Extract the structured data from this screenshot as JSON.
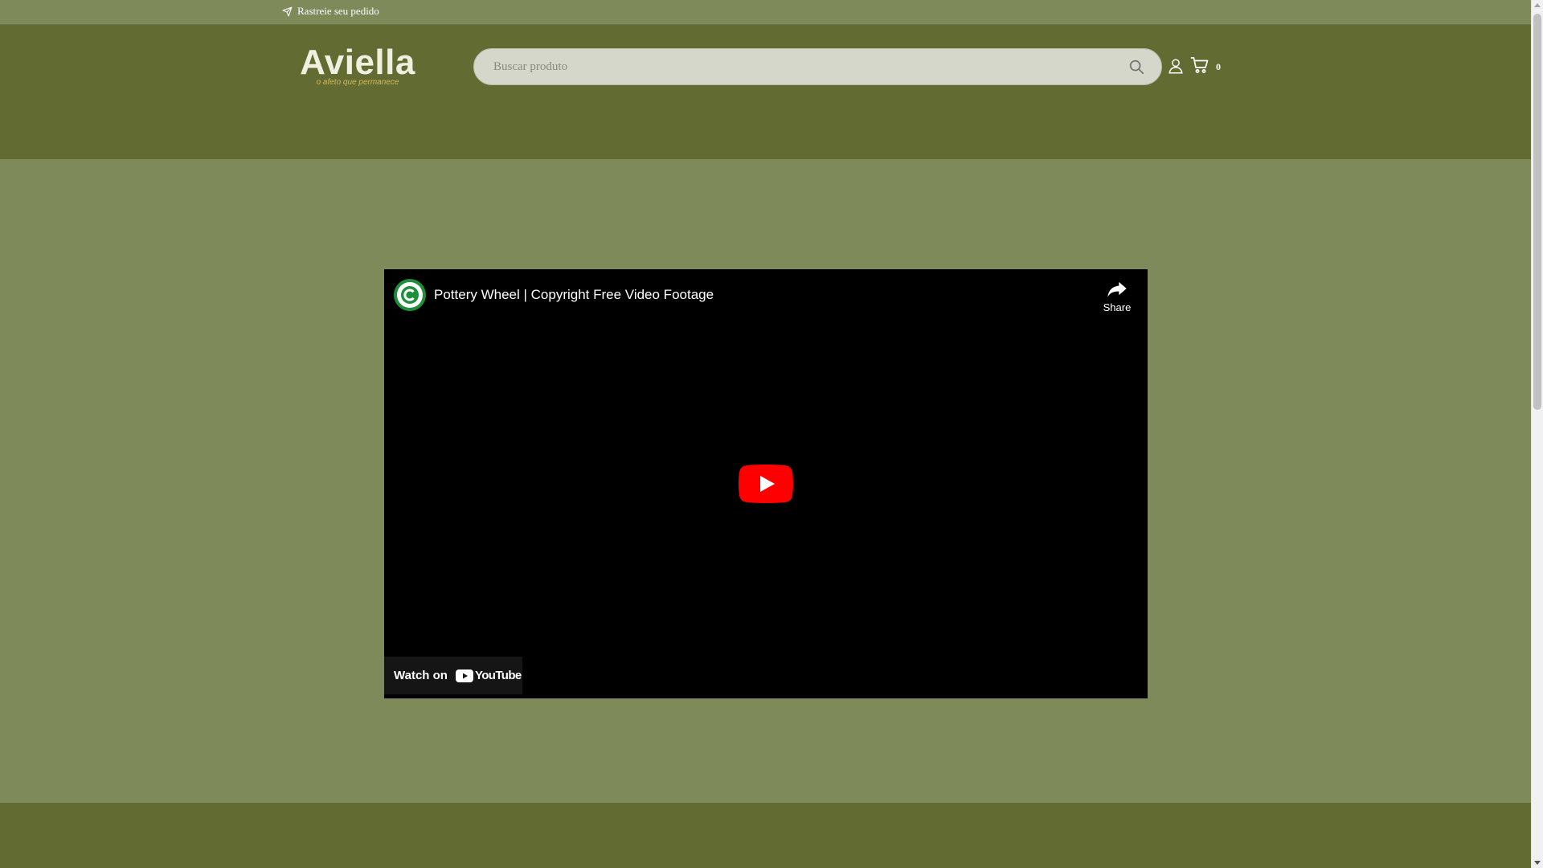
{
  "topbar": {
    "track_order_label": "Rastreie seu pedido"
  },
  "header": {
    "logo_text": "Aviella",
    "logo_tagline": "o afeto que permanece",
    "search": {
      "placeholder": "Buscar produto",
      "value": ""
    },
    "cart_count": "0"
  },
  "video": {
    "title": "Pottery Wheel | Copyright Free Video Footage",
    "share_label": "Share",
    "watch_on_label": "Watch on",
    "youtube_wordmark": "YouTube"
  },
  "colors": {
    "page_background": "#7f8a5b",
    "header_background": "#616b32",
    "logo_text": "#f1efe0",
    "logo_tagline": "#d4b95a",
    "search_background": "#d6d7cb",
    "youtube_red": "#ff0000",
    "channel_green": "#1f8e3b"
  },
  "icons": {
    "track": "send-icon",
    "search": "search-icon",
    "account": "user-icon",
    "cart": "cart-icon",
    "share": "share-arrow-icon",
    "play": "youtube-play-icon"
  }
}
